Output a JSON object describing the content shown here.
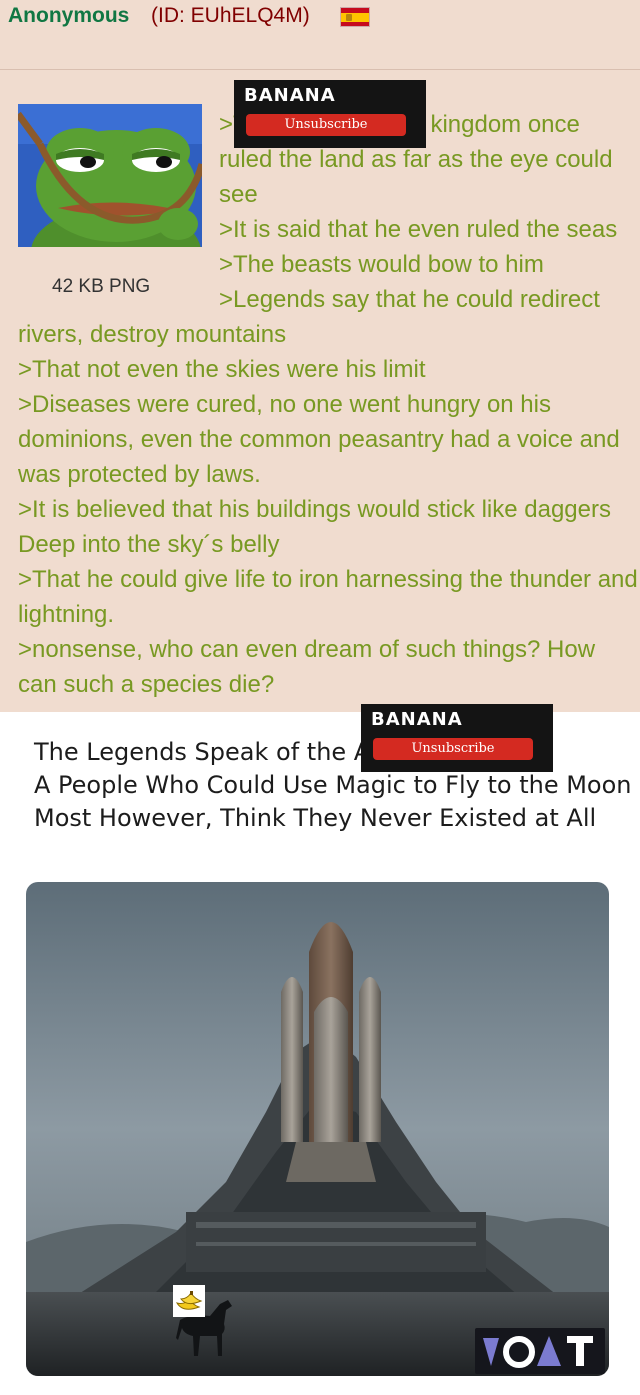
{
  "post": {
    "name": "Anonymous",
    "id": "(ID: EUhELQ4M)",
    "file_info": "42 KB PNG",
    "body_lines": [
      ">There once was a kingdom once ruled the land as far as the eye could see",
      ">It is said that he even ruled the seas",
      ">The beasts would bow to him",
      ">Legends say that he could redirect rivers, destroy mountains",
      ">That not even the skies were his limit",
      ">Diseases were cured, no one went hungry on his dominions, even the common peasantry had a voice and was protected by laws.",
      ">It is believed that his buildings would stick like daggers Deep into the sky´s belly",
      ">That he could give life to iron harnessing the thunder and lightning.",
      ">nonsense, who can even dream of such things? How can such a species die?"
    ]
  },
  "overlays": [
    {
      "title": "BANANA",
      "button": "Unsubscribe"
    },
    {
      "title": "BANANA",
      "button": "Unsubscribe"
    }
  ],
  "meme": {
    "caption_lines": [
      "The Legends Speak of the Ancients,",
      "A People Who Could Use Magic to Fly to the Moon",
      "Most However, Think They Never Existed at All"
    ]
  },
  "watermark": {
    "text": "VOAT",
    "accent": "#7b7bd0"
  },
  "colors": {
    "greentext": "#789922",
    "name": "#117743",
    "id": "#800000",
    "post_bg": "#f0dccf",
    "unsubscribe": "#d42a21"
  },
  "icons": {
    "flag": "spain-flag-icon",
    "thumbnail": "sad-frog-noose-thumbnail",
    "banana": "banana-icon"
  }
}
